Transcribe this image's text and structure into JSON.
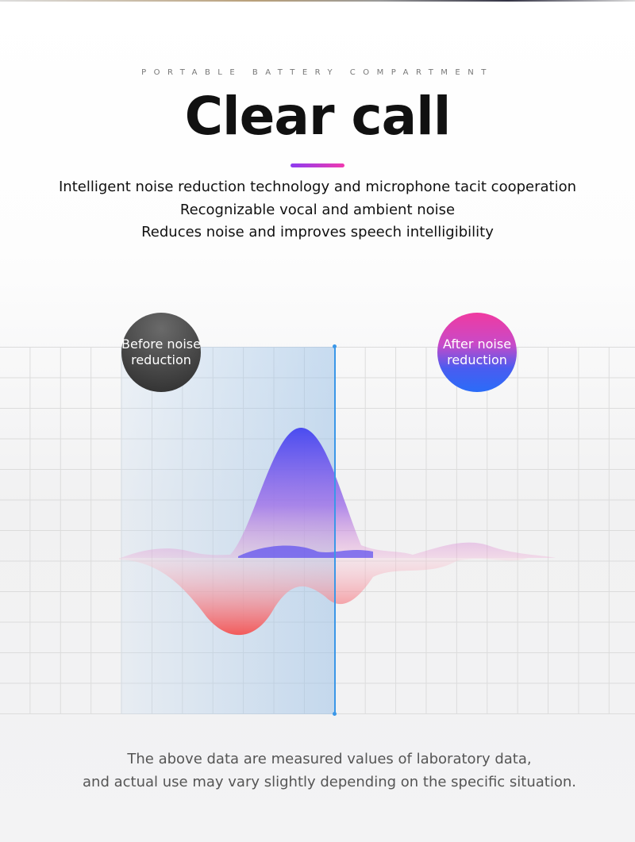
{
  "header": {
    "eyebrow": "PORTABLE BATTERY COMPARTMENT",
    "title": "Clear call"
  },
  "description": [
    "Intelligent noise reduction technology and microphone tacit cooperation",
    "Recognizable vocal and ambient noise",
    "Reduces noise and improves speech intelligibility"
  ],
  "comparison": {
    "before_label": "Before noise reduction",
    "after_label": "After noise reduction",
    "accent_colors": {
      "line": "#3a97e8",
      "upper_wave": "#5a4cf0",
      "lower_wave": "#f26a6a",
      "after_badge_top": "#f03aa0",
      "after_badge_bottom": "#2a6cf8"
    }
  },
  "footnote": [
    "The above data are measured values of laboratory data,",
    "and actual use may vary slightly depending on the specific situation."
  ]
}
